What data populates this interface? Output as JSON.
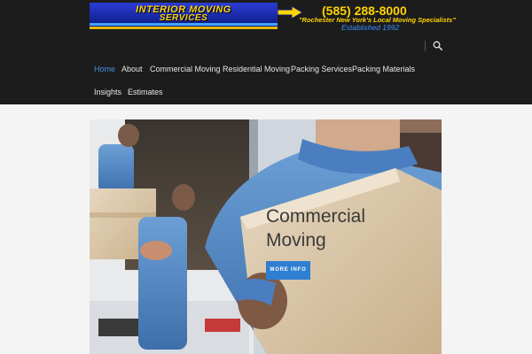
{
  "header": {
    "logo": {
      "line1": "INTERIOR MOVING",
      "line2": "SERVICES",
      "phone": "(585) 288-8000",
      "tagline": "\"Rochester New York's Local Moving Specialists\"",
      "established": "Established 1992"
    },
    "search_icon": "search-icon"
  },
  "nav": {
    "items": [
      {
        "label": "Home",
        "active": true
      },
      {
        "label": "About"
      },
      {
        "label": "Commercial Moving"
      },
      {
        "label": "Residential Moving"
      },
      {
        "label": "Packing Services"
      },
      {
        "label": "Packing Materials"
      },
      {
        "label": "Insights"
      },
      {
        "label": "Estimates"
      }
    ]
  },
  "hero": {
    "title": "Commercial Moving",
    "button_label": "MORE INFO"
  },
  "colors": {
    "header_bg": "#1c1c1c",
    "nav_active": "#4a90e2",
    "button_bg": "#2f7fd1",
    "logo_yellow": "#ffd400"
  }
}
